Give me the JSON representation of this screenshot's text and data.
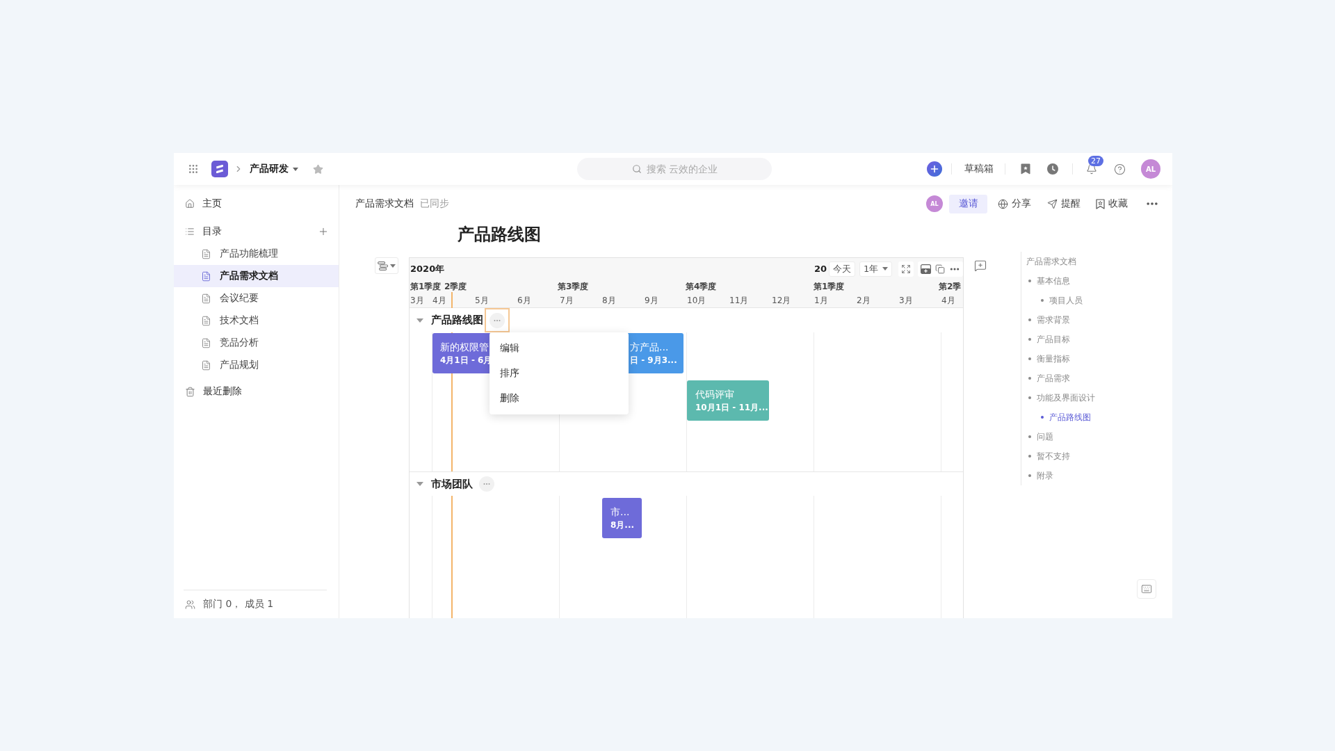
{
  "topbar": {
    "workspace": "产品研发",
    "search": {
      "placeholder": "搜索 云效的企业"
    },
    "drafts": "草稿箱",
    "notifications": {
      "badge": "27"
    },
    "avatar": "AL"
  },
  "sidebar": {
    "home": "主页",
    "catalog": {
      "label": "目录",
      "items": [
        {
          "label": "产品功能梳理",
          "selected": false
        },
        {
          "label": "产品需求文档",
          "selected": true
        },
        {
          "label": "会议纪要",
          "selected": false
        },
        {
          "label": "技术文档",
          "selected": false
        },
        {
          "label": "竞品分析",
          "selected": false
        },
        {
          "label": "产品规划",
          "selected": false
        }
      ]
    },
    "trash": "最近删除",
    "footer": "部门 0， 成员 1"
  },
  "document": {
    "breadcrumb": "产品需求文档",
    "sync_status": "已同步",
    "collaborator": "AL",
    "invite": "邀请",
    "actions": [
      {
        "kind": "share",
        "label": "分享"
      },
      {
        "kind": "remind",
        "label": "提醒"
      },
      {
        "kind": "favorite",
        "label": "收藏"
      }
    ],
    "title": "产品路线图"
  },
  "timeline": {
    "year": "2020年",
    "next_year": "20",
    "today_button": "今天",
    "range": "1年",
    "quarters": [
      "第1季度",
      "2季度",
      "第3季度",
      "第4季度",
      "第1季度",
      "第2季"
    ],
    "months": [
      "3月",
      "4月",
      "5月",
      "6月",
      "7月",
      "8月",
      "9月",
      "10月",
      "11月",
      "12月",
      "1月",
      "2月",
      "3月",
      "4月"
    ],
    "context_menu": [
      "编辑",
      "排序",
      "删除"
    ],
    "groups": [
      {
        "name": "产品路线图",
        "expanded": true,
        "menu_open": true,
        "bars": [
          {
            "title": "新的权限管",
            "dates": "4月1日 - 6月",
            "color": "#6e6bd9"
          },
          {
            "title": "方产品...",
            "dates": "日 - 9月3...",
            "color": "#4a99e8"
          },
          {
            "title": "代码评审",
            "dates": "10月1日 - 11月...",
            "color": "#5cb9ae"
          }
        ]
      },
      {
        "name": "市场团队",
        "expanded": true,
        "menu_open": false,
        "bars": [
          {
            "title": "市...",
            "dates": "8月...",
            "color": "#6e6bd9"
          }
        ]
      }
    ]
  },
  "outline": {
    "title": "产品需求文档",
    "items": [
      {
        "label": "基本信息",
        "selected": false,
        "children": [
          {
            "label": "项目人员",
            "selected": false
          }
        ]
      },
      {
        "label": "需求背景",
        "selected": false
      },
      {
        "label": "产品目标",
        "selected": false
      },
      {
        "label": "衡量指标",
        "selected": false
      },
      {
        "label": "产品需求",
        "selected": false
      },
      {
        "label": "功能及界面设计",
        "selected": false,
        "children": [
          {
            "label": "产品路线图",
            "selected": true
          }
        ]
      },
      {
        "label": "问题",
        "selected": false
      },
      {
        "label": "暂不支持",
        "selected": false
      },
      {
        "label": "附录",
        "selected": false
      }
    ]
  }
}
